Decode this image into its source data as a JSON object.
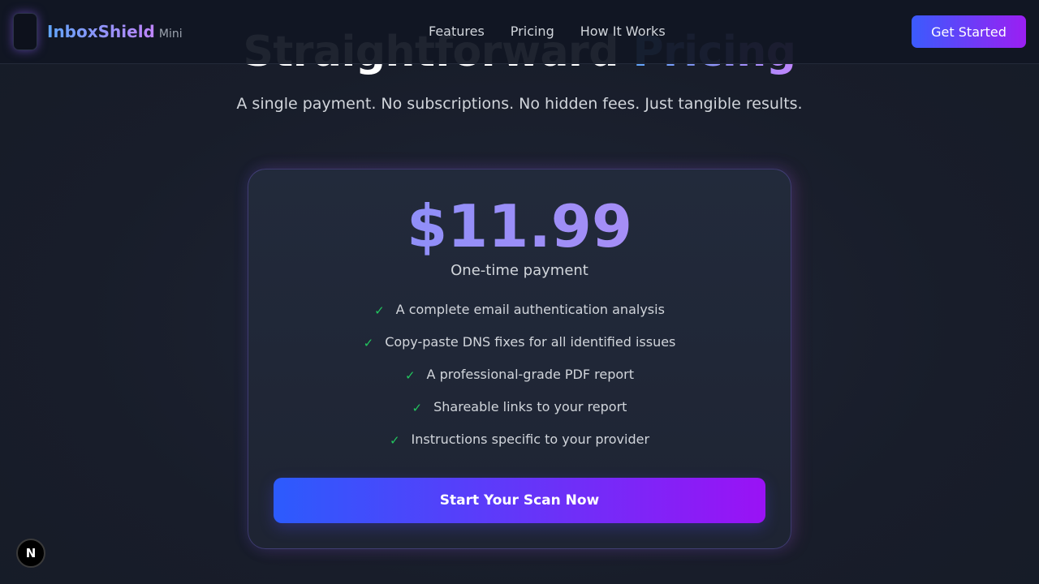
{
  "header": {
    "brand": "InboxShield",
    "brand_suffix": "Mini",
    "nav": [
      {
        "label": "Features"
      },
      {
        "label": "Pricing"
      },
      {
        "label": "How It Works"
      }
    ],
    "cta_label": "Get Started"
  },
  "hero": {
    "title_main": "Straightforward",
    "title_accent": "Pricing",
    "subtitle": "A single payment. No subscriptions. No hidden fees. Just tangible results."
  },
  "pricing_card": {
    "price": "$11.99",
    "payment_note": "One-time payment",
    "features": [
      "A complete email authentication analysis",
      "Copy-paste DNS fixes for all identified issues",
      "A professional-grade PDF report",
      "Shareable links to your report",
      "Instructions specific to your provider"
    ],
    "cta_label": "Start Your Scan Now"
  },
  "dev_badge": {
    "label": "N"
  },
  "colors": {
    "accent_blue": "#3b5bfd",
    "accent_purple": "#9b1ff2",
    "check_green": "#22c55e",
    "background": "#1a1f2e"
  },
  "icons": {
    "check": "check-icon",
    "logo": "logo-icon"
  }
}
